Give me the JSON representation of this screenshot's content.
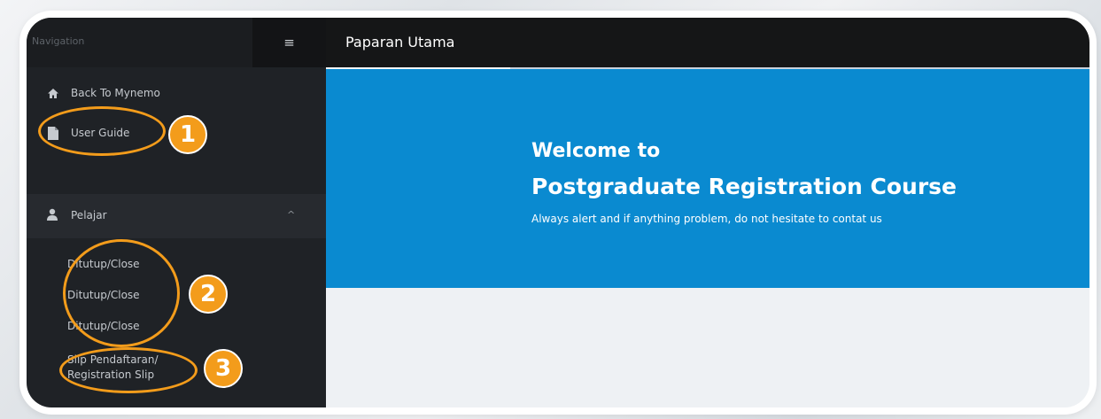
{
  "sidebar": {
    "nav_label": "Navigation",
    "menu_icon": "hamburger-icon",
    "items": [
      {
        "label": "Back To Mynemo",
        "icon": "home-icon"
      },
      {
        "label": "User Guide",
        "icon": "document-icon"
      }
    ],
    "section": {
      "label": "Pelajar",
      "icon": "user-icon",
      "caret": "^"
    },
    "sub_items": [
      "Ditutup/Close",
      "Ditutup/Close",
      "Ditutup/Close",
      "Slip Pendaftaran/",
      "Registration Slip"
    ]
  },
  "topbar": {
    "title": "Paparan Utama"
  },
  "hero": {
    "line1": "Welcome to",
    "line2": "Postgraduate Registration Course",
    "subtitle": "Always alert and if anything problem, do not hesitate to contat us"
  },
  "annotations": [
    "1",
    "2",
    "3"
  ],
  "colors": {
    "accent": "#f39c1b",
    "hero": "#0a8ad0",
    "sidebar": "#1f2226"
  }
}
